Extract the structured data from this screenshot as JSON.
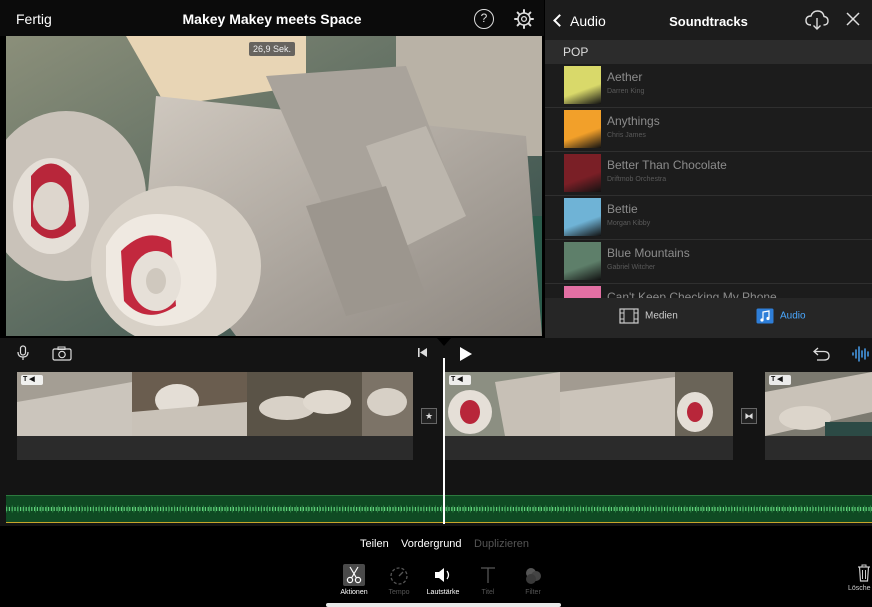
{
  "topbar": {
    "done_label": "Fertig",
    "project_title": "Makey Makey meets Space",
    "help_glyph": "?"
  },
  "viewer": {
    "timecode": "26,9 Sek."
  },
  "browser": {
    "back_label": "Audio",
    "title": "Soundtracks",
    "section": "POP",
    "tracks": [
      {
        "name": "Aether",
        "artist": "Darren King",
        "art_color": "#d9d96a"
      },
      {
        "name": "Anythings",
        "artist": "Chris James",
        "art_color": "#f2a02a"
      },
      {
        "name": "Better Than Chocolate",
        "artist": "Driftmob Orchestra",
        "art_color": "#7a1f26"
      },
      {
        "name": "Bettie",
        "artist": "Morgan Kibby",
        "art_color": "#6fb3d6"
      },
      {
        "name": "Blue Mountains",
        "artist": "Gabriel Witcher",
        "art_color": "#5e7f6a"
      },
      {
        "name": "Can't Keep Checking My Phone",
        "artist": "",
        "art_color": "#e36fa3"
      }
    ],
    "tabs": {
      "media_label": "Medien",
      "audio_label": "Audio"
    }
  },
  "timeline": {
    "clips": [
      {
        "badge": "T ◀"
      },
      {
        "badge": "T ◀"
      },
      {
        "badge": "T ◀"
      }
    ],
    "transitions": [
      "★",
      "⧓"
    ]
  },
  "inspector": {
    "actions": {
      "split": "Teilen",
      "foreground": "Vordergrund",
      "duplicate": "Duplizieren"
    },
    "tools": {
      "actions": "Aktionen",
      "speed": "Tempo",
      "volume": "Lautstärke",
      "title": "Titel",
      "filter": "Filter"
    },
    "delete_label": "Lösche"
  },
  "colors": {
    "accent": "#4aa8ff",
    "audio_track": "#0f4a23"
  }
}
